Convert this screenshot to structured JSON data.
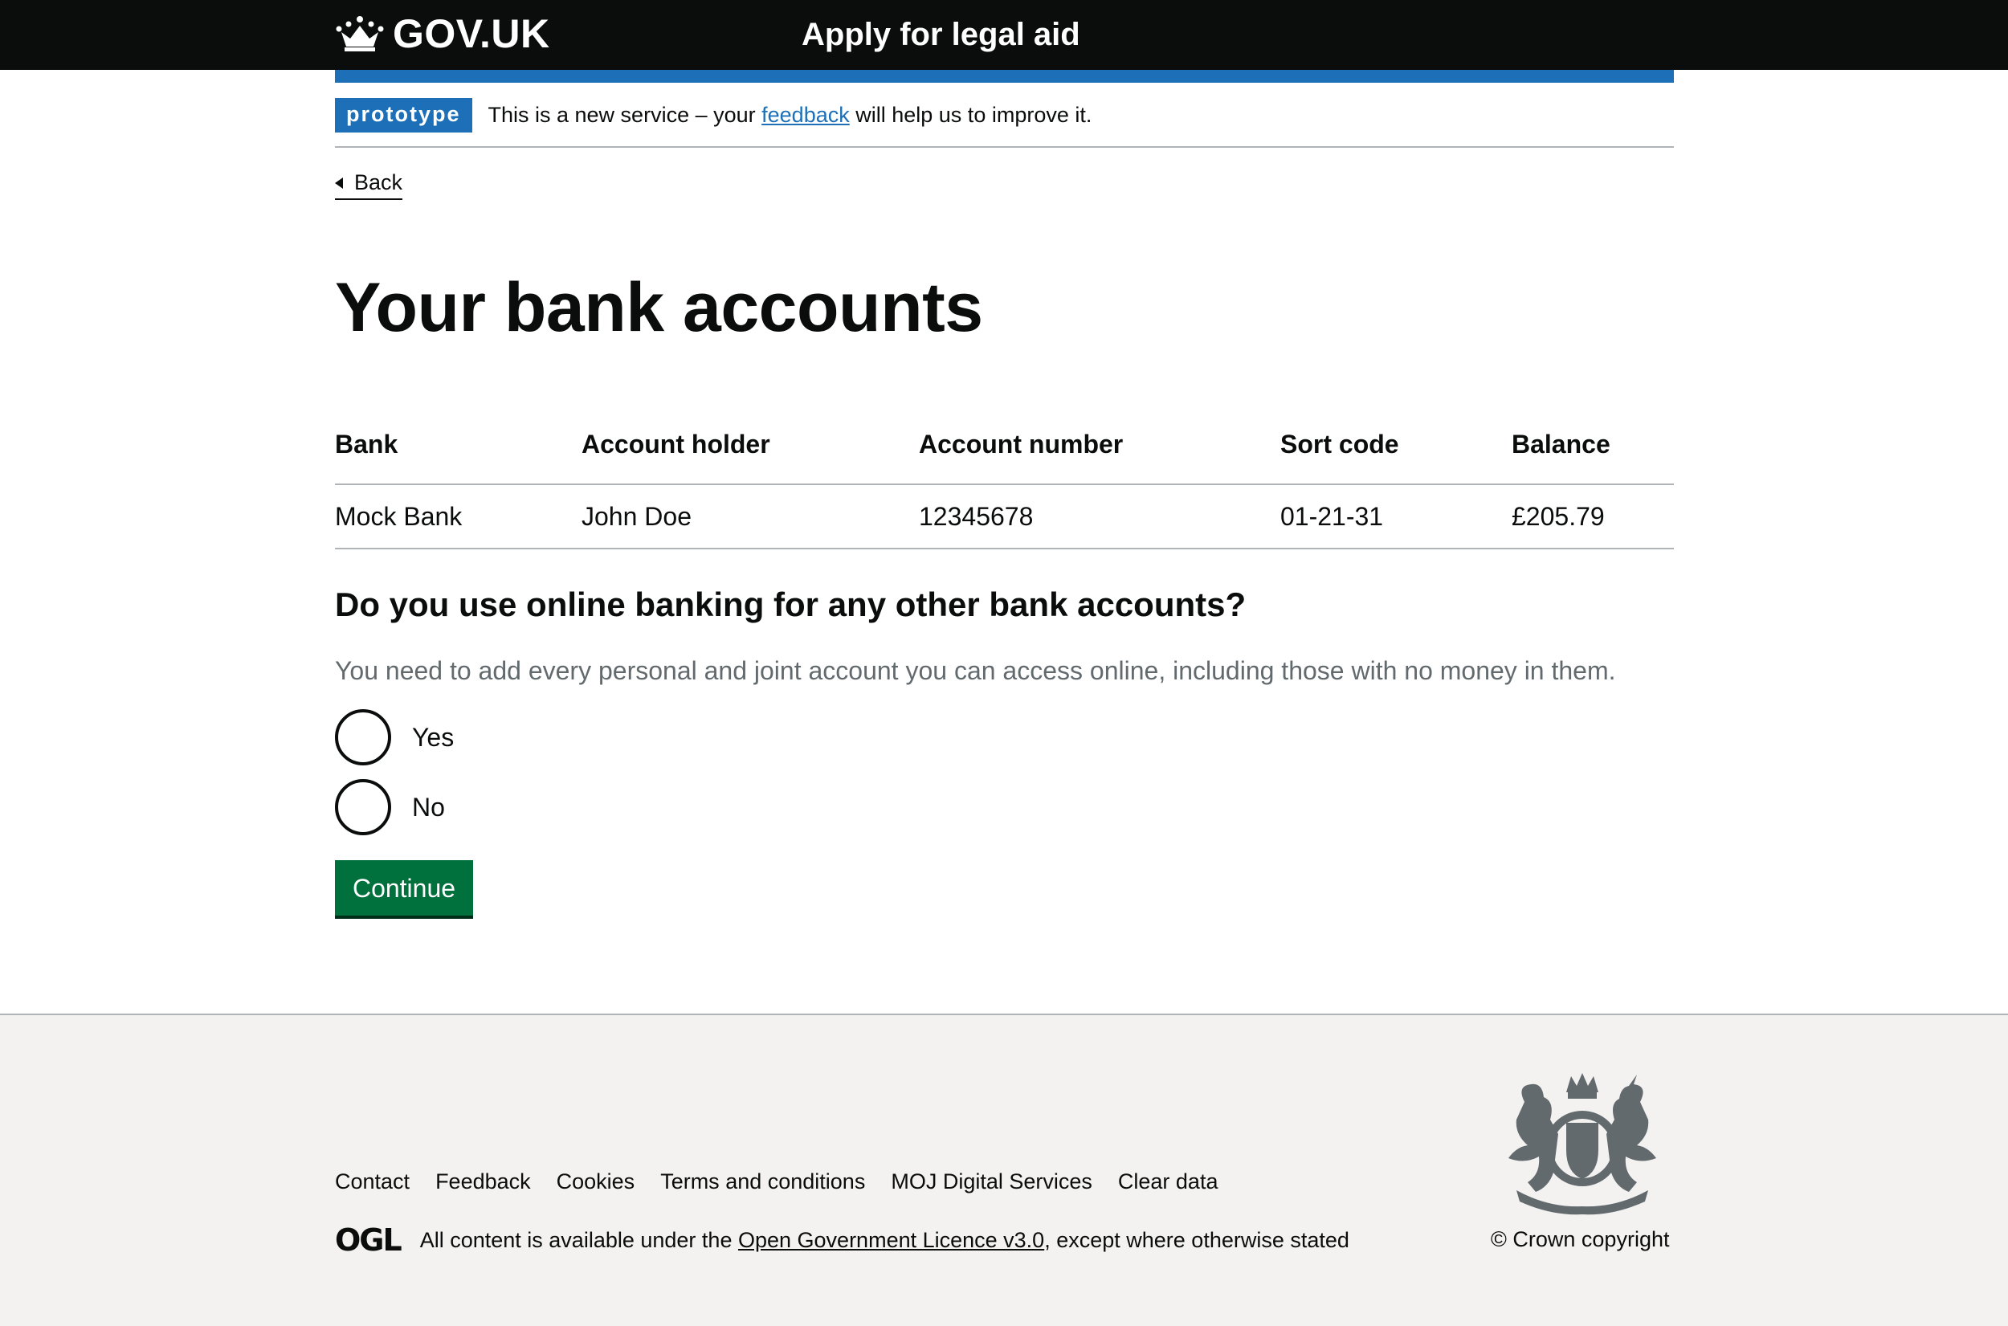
{
  "header": {
    "logo_text": "GOV.UK",
    "service_name": "Apply for legal aid"
  },
  "phase_banner": {
    "tag": "prototype",
    "text_before": "This is a new service – your",
    "link_text": "feedback",
    "text_after": "will help us to improve it."
  },
  "back_link": "Back",
  "page_title": "Your bank accounts",
  "accounts_table": {
    "headers": [
      "Bank",
      "Account holder",
      "Account number",
      "Sort code",
      "Balance"
    ],
    "rows": [
      [
        "Mock Bank",
        "John Doe",
        "12345678",
        "01-21-31",
        "£205.79"
      ]
    ]
  },
  "question": {
    "heading": "Do you use online banking for any other bank accounts?",
    "hint": "You need to add every personal and joint account you can access online, including those with no money in them.",
    "options": [
      "Yes",
      "No"
    ]
  },
  "continue_button": "Continue",
  "footer": {
    "links": [
      "Contact",
      "Feedback",
      "Cookies",
      "Terms and conditions",
      "MOJ Digital Services",
      "Clear data"
    ],
    "ogl_logo": "OGL",
    "licence_before": "All content is available under the",
    "licence_link": "Open Government Licence v3.0",
    "licence_after": ", except where otherwise stated",
    "copyright": "© Crown copyright",
    "crest_icon": "royal-coat-of-arms-icon"
  },
  "colors": {
    "header_bg": "#0b0c0c",
    "brand_blue": "#1d70b8",
    "button_green": "#00703c",
    "footer_bg": "#f3f2f1",
    "hint_grey": "#626a6e"
  }
}
